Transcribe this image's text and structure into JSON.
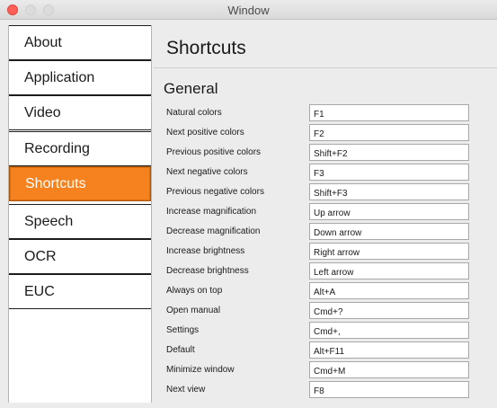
{
  "window": {
    "title": "Window"
  },
  "sidebar": {
    "items": [
      {
        "label": "About",
        "active": false
      },
      {
        "label": "Application",
        "active": false
      },
      {
        "label": "Video",
        "active": false
      },
      {
        "label": "Recording",
        "active": false
      },
      {
        "label": "Shortcuts",
        "active": true
      },
      {
        "label": "Speech",
        "active": false
      },
      {
        "label": "OCR",
        "active": false
      },
      {
        "label": "EUC",
        "active": false
      }
    ]
  },
  "main": {
    "page_title": "Shortcuts",
    "section_title": "General",
    "shortcuts": [
      {
        "label": "Natural colors",
        "value": "F1"
      },
      {
        "label": "Next positive colors",
        "value": "F2"
      },
      {
        "label": "Previous positive colors",
        "value": "Shift+F2"
      },
      {
        "label": "Next negative colors",
        "value": "F3"
      },
      {
        "label": "Previous negative colors",
        "value": "Shift+F3"
      },
      {
        "label": "Increase magnification",
        "value": "Up arrow"
      },
      {
        "label": "Decrease magnification",
        "value": "Down arrow"
      },
      {
        "label": "Increase brightness",
        "value": "Right arrow"
      },
      {
        "label": "Decrease brightness",
        "value": "Left arrow"
      },
      {
        "label": "Always on top",
        "value": "Alt+A"
      },
      {
        "label": "Open manual",
        "value": "Cmd+?"
      },
      {
        "label": "Settings",
        "value": "Cmd+,"
      },
      {
        "label": "Default",
        "value": "Alt+F11"
      },
      {
        "label": "Minimize window",
        "value": "Cmd+M"
      },
      {
        "label": "Next view",
        "value": "F8"
      }
    ]
  },
  "colors": {
    "accent": "#f5821f",
    "close_button": "#fe5f57",
    "background": "#ececec"
  }
}
